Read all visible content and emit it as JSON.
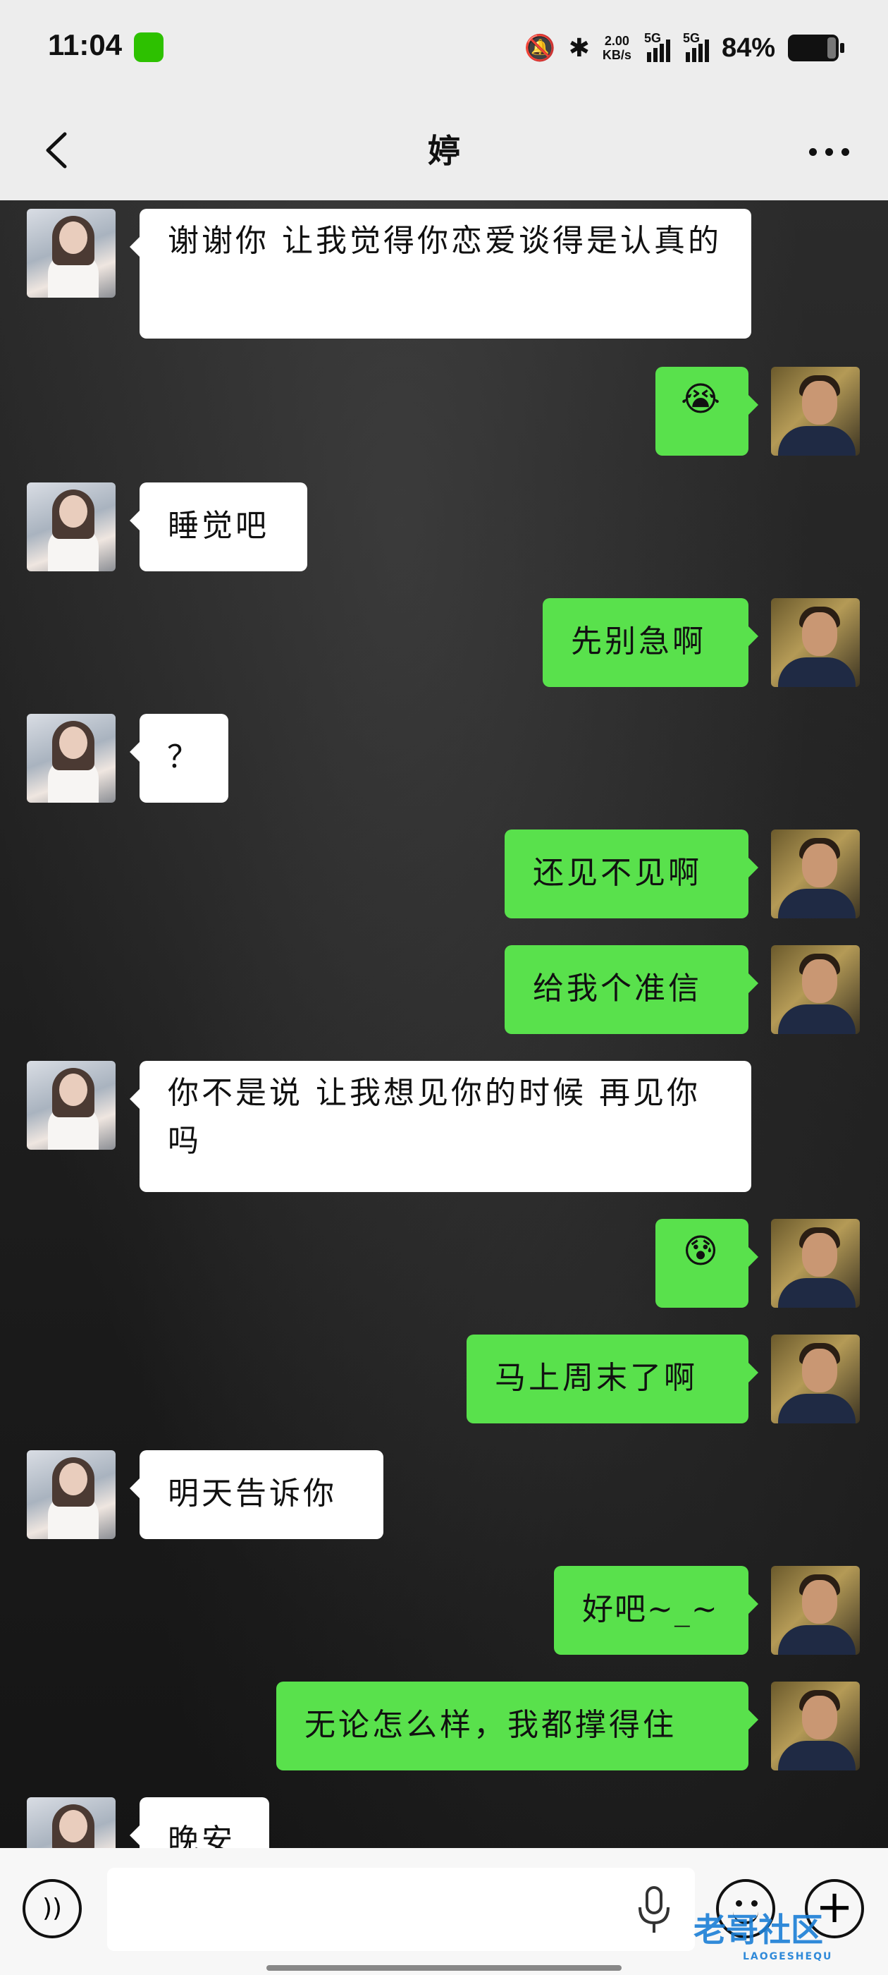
{
  "status_bar": {
    "time": "11:04",
    "net_speed_value": "2.00",
    "net_speed_unit": "KB/s",
    "signal1": "5G",
    "signal2": "5G",
    "battery": "84%"
  },
  "nav": {
    "title": "婷"
  },
  "messages": [
    {
      "from": "her",
      "text": "谢谢你 让我觉得你恋爱谈得是认真的"
    },
    {
      "from": "me",
      "text": "😭"
    },
    {
      "from": "her",
      "text": "睡觉吧"
    },
    {
      "from": "me",
      "text": "先别急啊"
    },
    {
      "from": "her",
      "text": "？"
    },
    {
      "from": "me",
      "text": "还见不见啊"
    },
    {
      "from": "me",
      "text": "给我个准信"
    },
    {
      "from": "her",
      "text": "你不是说 让我想见你的时候 再见你吗"
    },
    {
      "from": "me",
      "text": "😰"
    },
    {
      "from": "me",
      "text": "马上周末了啊"
    },
    {
      "from": "her",
      "text": "明天告诉你"
    },
    {
      "from": "me",
      "text": "好吧~_~"
    },
    {
      "from": "me",
      "text": "无论怎么样，我都撑得住"
    },
    {
      "from": "her",
      "text": "晚安"
    }
  ],
  "input": {
    "placeholder": ""
  },
  "watermark": {
    "text": "老哥社区",
    "sub": "LAOGESHEQU"
  },
  "colors": {
    "outgoing_bubble": "#59e14c",
    "incoming_bubble": "#ffffff",
    "bar_background": "#ededed"
  }
}
